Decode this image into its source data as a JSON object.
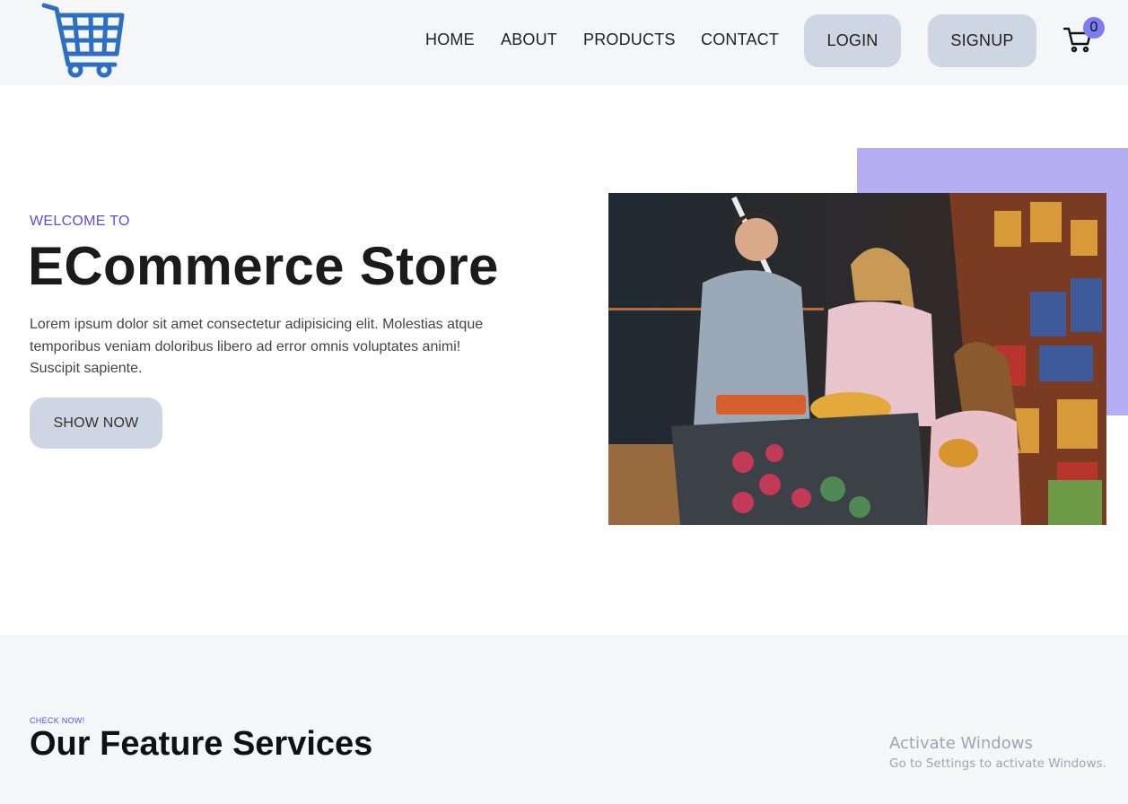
{
  "header": {
    "logo_icon": "shopping-cart-logo",
    "nav": [
      "HOME",
      "ABOUT",
      "PRODUCTS",
      "CONTACT"
    ],
    "login_label": "LOGIN",
    "signup_label": "SIGNUP",
    "cart_count": "0"
  },
  "hero": {
    "kicker": "WELCOME TO",
    "title": "ECommerce Store",
    "description": "Lorem ipsum dolor sit amet consectetur adipisicing elit. Molestias atque temporibus veniam doloribus libero ad error omnis voluptates animi! Suscipit sapiente.",
    "cta_label": "SHOW NOW",
    "accent_color": "#b5aef4"
  },
  "services": {
    "kicker": "CHECK NOW!",
    "title": "Our Feature Services"
  },
  "watermark": {
    "line1": "Activate Windows",
    "line2": "Go to Settings to activate Windows."
  },
  "colors": {
    "brand_blue": "#2d6fc0",
    "accent_purple": "#5a4fe0",
    "button_bg": "#cdd6e2"
  }
}
